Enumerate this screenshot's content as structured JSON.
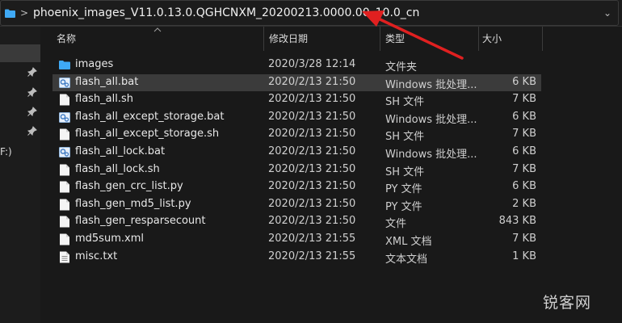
{
  "address_bar": {
    "path": "phoenix_images_V11.0.13.0.QGHCNXM_20200213.0000.00_10.0_cn",
    "separator": ">",
    "dropdown": "⌄"
  },
  "nav": {
    "drive_label": "F:)"
  },
  "columns": {
    "name": "名称",
    "date": "修改日期",
    "type": "类型",
    "size": "大小"
  },
  "files": [
    {
      "name": "images",
      "date": "2020/3/28 12:14",
      "type": "文件夹",
      "size": "",
      "icon": "folder-icon"
    },
    {
      "name": "flash_all.bat",
      "date": "2020/2/13 21:50",
      "type": "Windows 批处理...",
      "size": "6 KB",
      "icon": "batch-file-icon",
      "selected": true
    },
    {
      "name": "flash_all.sh",
      "date": "2020/2/13 21:50",
      "type": "SH 文件",
      "size": "7 KB",
      "icon": "file-icon"
    },
    {
      "name": "flash_all_except_storage.bat",
      "date": "2020/2/13 21:50",
      "type": "Windows 批处理...",
      "size": "6 KB",
      "icon": "batch-file-icon"
    },
    {
      "name": "flash_all_except_storage.sh",
      "date": "2020/2/13 21:50",
      "type": "SH 文件",
      "size": "7 KB",
      "icon": "file-icon"
    },
    {
      "name": "flash_all_lock.bat",
      "date": "2020/2/13 21:50",
      "type": "Windows 批处理...",
      "size": "6 KB",
      "icon": "batch-file-icon"
    },
    {
      "name": "flash_all_lock.sh",
      "date": "2020/2/13 21:50",
      "type": "SH 文件",
      "size": "7 KB",
      "icon": "file-icon"
    },
    {
      "name": "flash_gen_crc_list.py",
      "date": "2020/2/13 21:50",
      "type": "PY 文件",
      "size": "6 KB",
      "icon": "file-icon"
    },
    {
      "name": "flash_gen_md5_list.py",
      "date": "2020/2/13 21:50",
      "type": "PY 文件",
      "size": "2 KB",
      "icon": "file-icon"
    },
    {
      "name": "flash_gen_resparsecount",
      "date": "2020/2/13 21:50",
      "type": "文件",
      "size": "843 KB",
      "icon": "file-icon"
    },
    {
      "name": "md5sum.xml",
      "date": "2020/2/13 21:55",
      "type": "XML 文档",
      "size": "7 KB",
      "icon": "file-icon"
    },
    {
      "name": "misc.txt",
      "date": "2020/2/13 21:55",
      "type": "文本文档",
      "size": "1 KB",
      "icon": "text-file-icon"
    }
  ],
  "watermark": "锐客网",
  "colors": {
    "folder": "#3fa9f5",
    "selection": "#3b3b3b",
    "arrow": "#e02020"
  }
}
